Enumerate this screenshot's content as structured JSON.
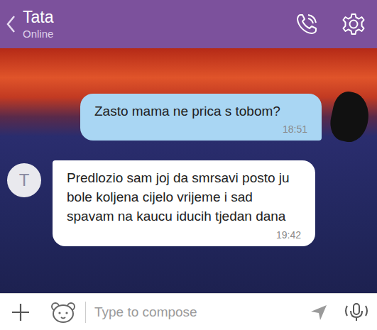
{
  "header": {
    "title": "Tata",
    "status": "Online"
  },
  "messages": [
    {
      "direction": "outgoing",
      "text": "Zasto mama ne prica s tobom?",
      "time": "18:51",
      "avatar": ""
    },
    {
      "direction": "incoming",
      "text": "Predlozio sam joj da smrsavi posto ju bole koljena cijelo vrijeme i sad spavam na kaucu iducih tjedan dana",
      "time": "19:42",
      "avatar": "T"
    }
  ],
  "composer": {
    "placeholder": "Type to compose"
  }
}
